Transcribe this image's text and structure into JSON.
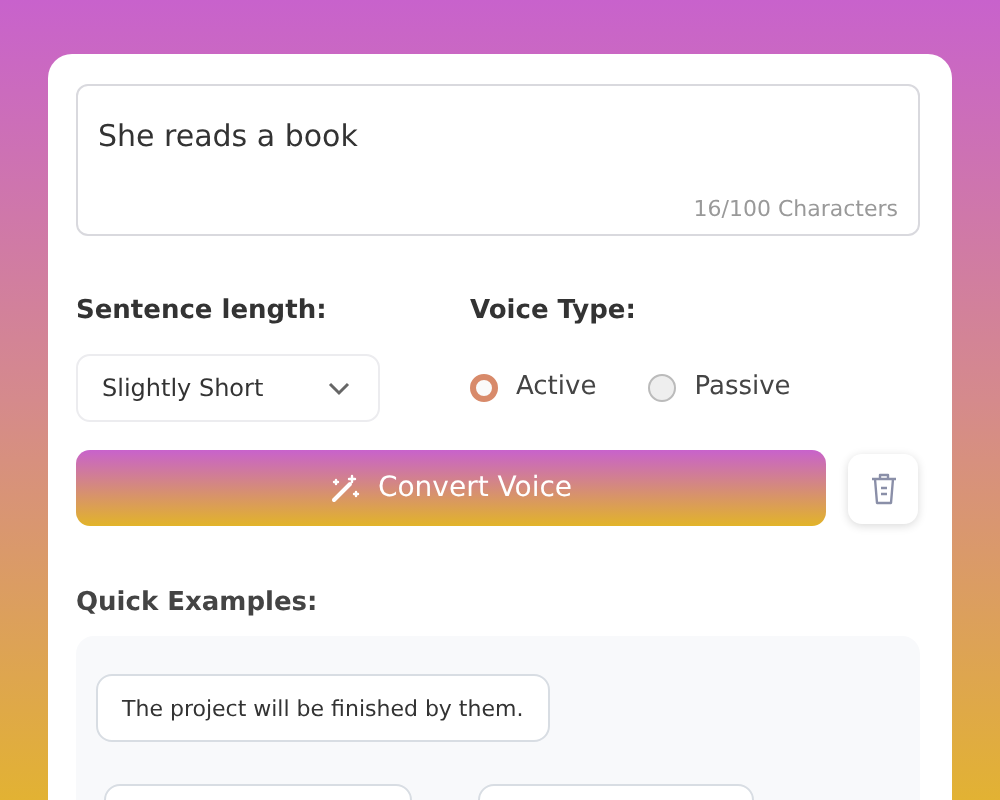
{
  "input": {
    "value": "She reads a book",
    "counter": "16/100 Characters"
  },
  "sentence_length": {
    "label": "Sentence length:",
    "value": "Slightly Short"
  },
  "voice_type": {
    "label": "Voice Type:",
    "options": [
      {
        "label": "Active",
        "selected": true
      },
      {
        "label": "Passive",
        "selected": false
      }
    ]
  },
  "convert_button": {
    "label": "Convert Voice"
  },
  "quick_examples": {
    "title": "Quick Examples:",
    "items": [
      "The project will be finished by them."
    ]
  }
}
